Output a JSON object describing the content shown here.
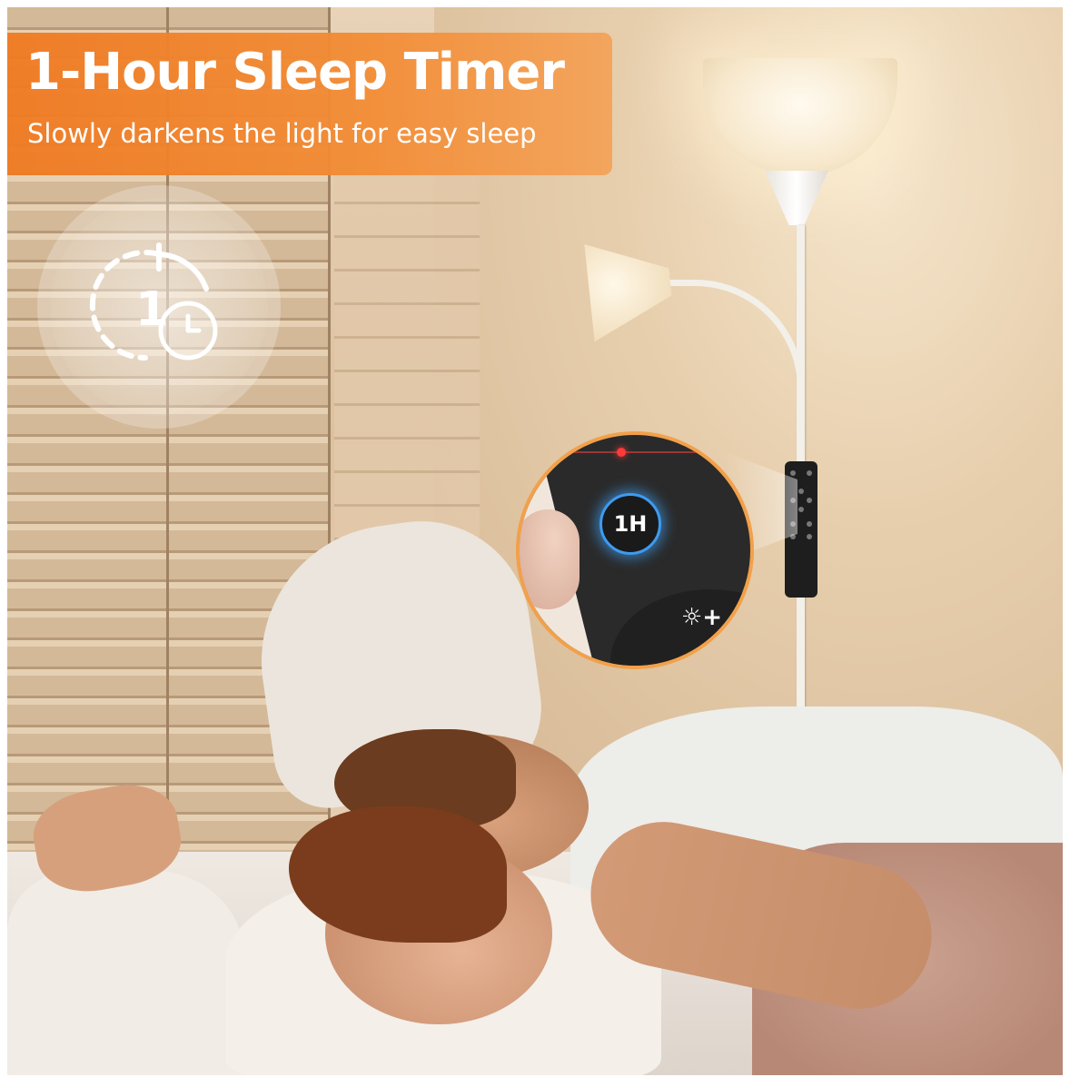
{
  "banner": {
    "title": "1-Hour Sleep Timer",
    "subtitle": "Slowly darkens the light for easy sleep",
    "color": "#f07a22"
  },
  "timer_icon": {
    "icon": "timer-1-hour-icon",
    "digit": "1"
  },
  "zoom": {
    "button_label": "1H",
    "brightness_label": "☼+",
    "button_glow_color": "#3e9bf0",
    "ring_color": "#f2a04a"
  }
}
